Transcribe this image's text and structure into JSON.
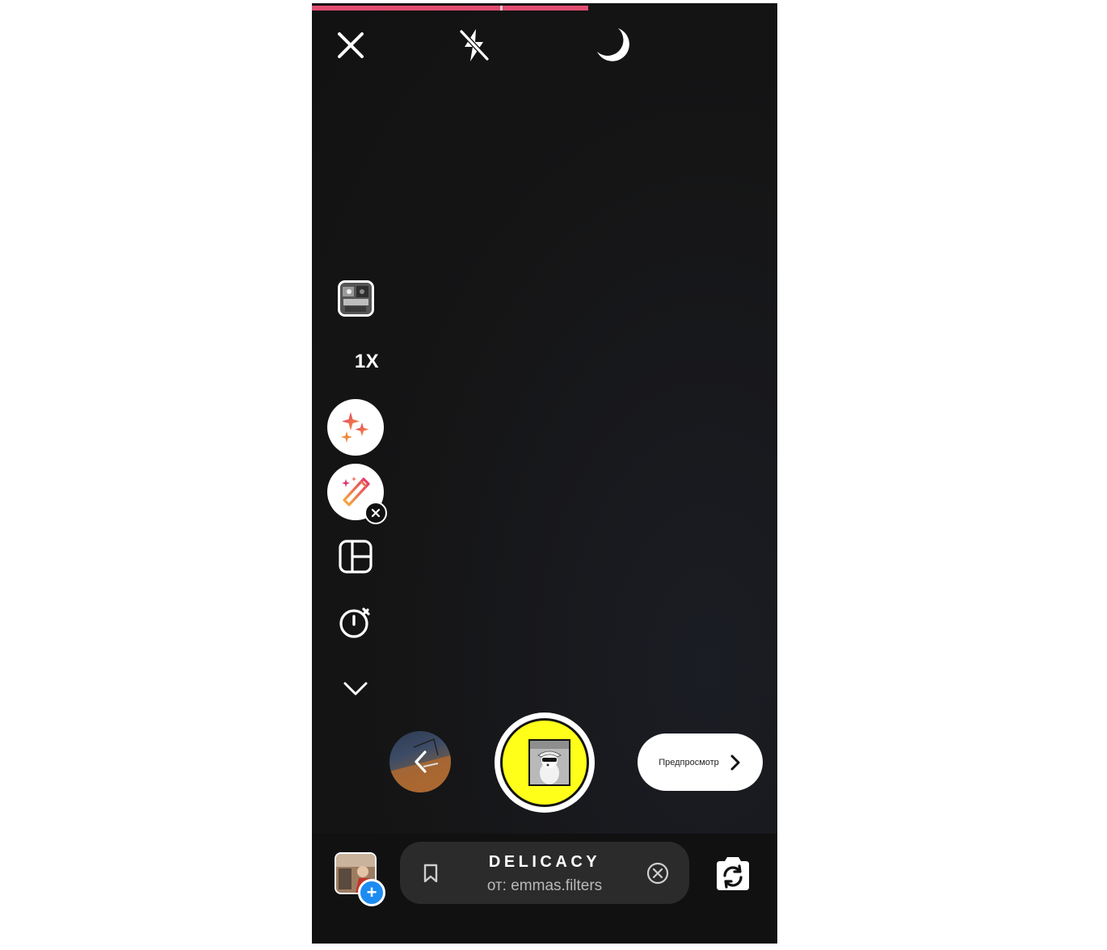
{
  "camera": {
    "zoom_label": "1X",
    "top_bar": {
      "close_icon": "close-icon",
      "flash_icon": "flash-off-icon",
      "night_mode_icon": "moon-icon"
    },
    "side_tools": [
      "layout-thumbnail-icon",
      "effects-sparkle-icon",
      "magic-wand-icon",
      "layout-grid-icon",
      "timer-icon",
      "chevron-down-icon"
    ],
    "preview_button": {
      "label": "Предпросмотр"
    },
    "colors": {
      "progress": "#e24c71",
      "shutter_ring": "#ffff1a",
      "accent_blue": "#1d8cf2"
    }
  },
  "effect": {
    "name": "DELICACY",
    "author": "от: emmas.filters"
  }
}
